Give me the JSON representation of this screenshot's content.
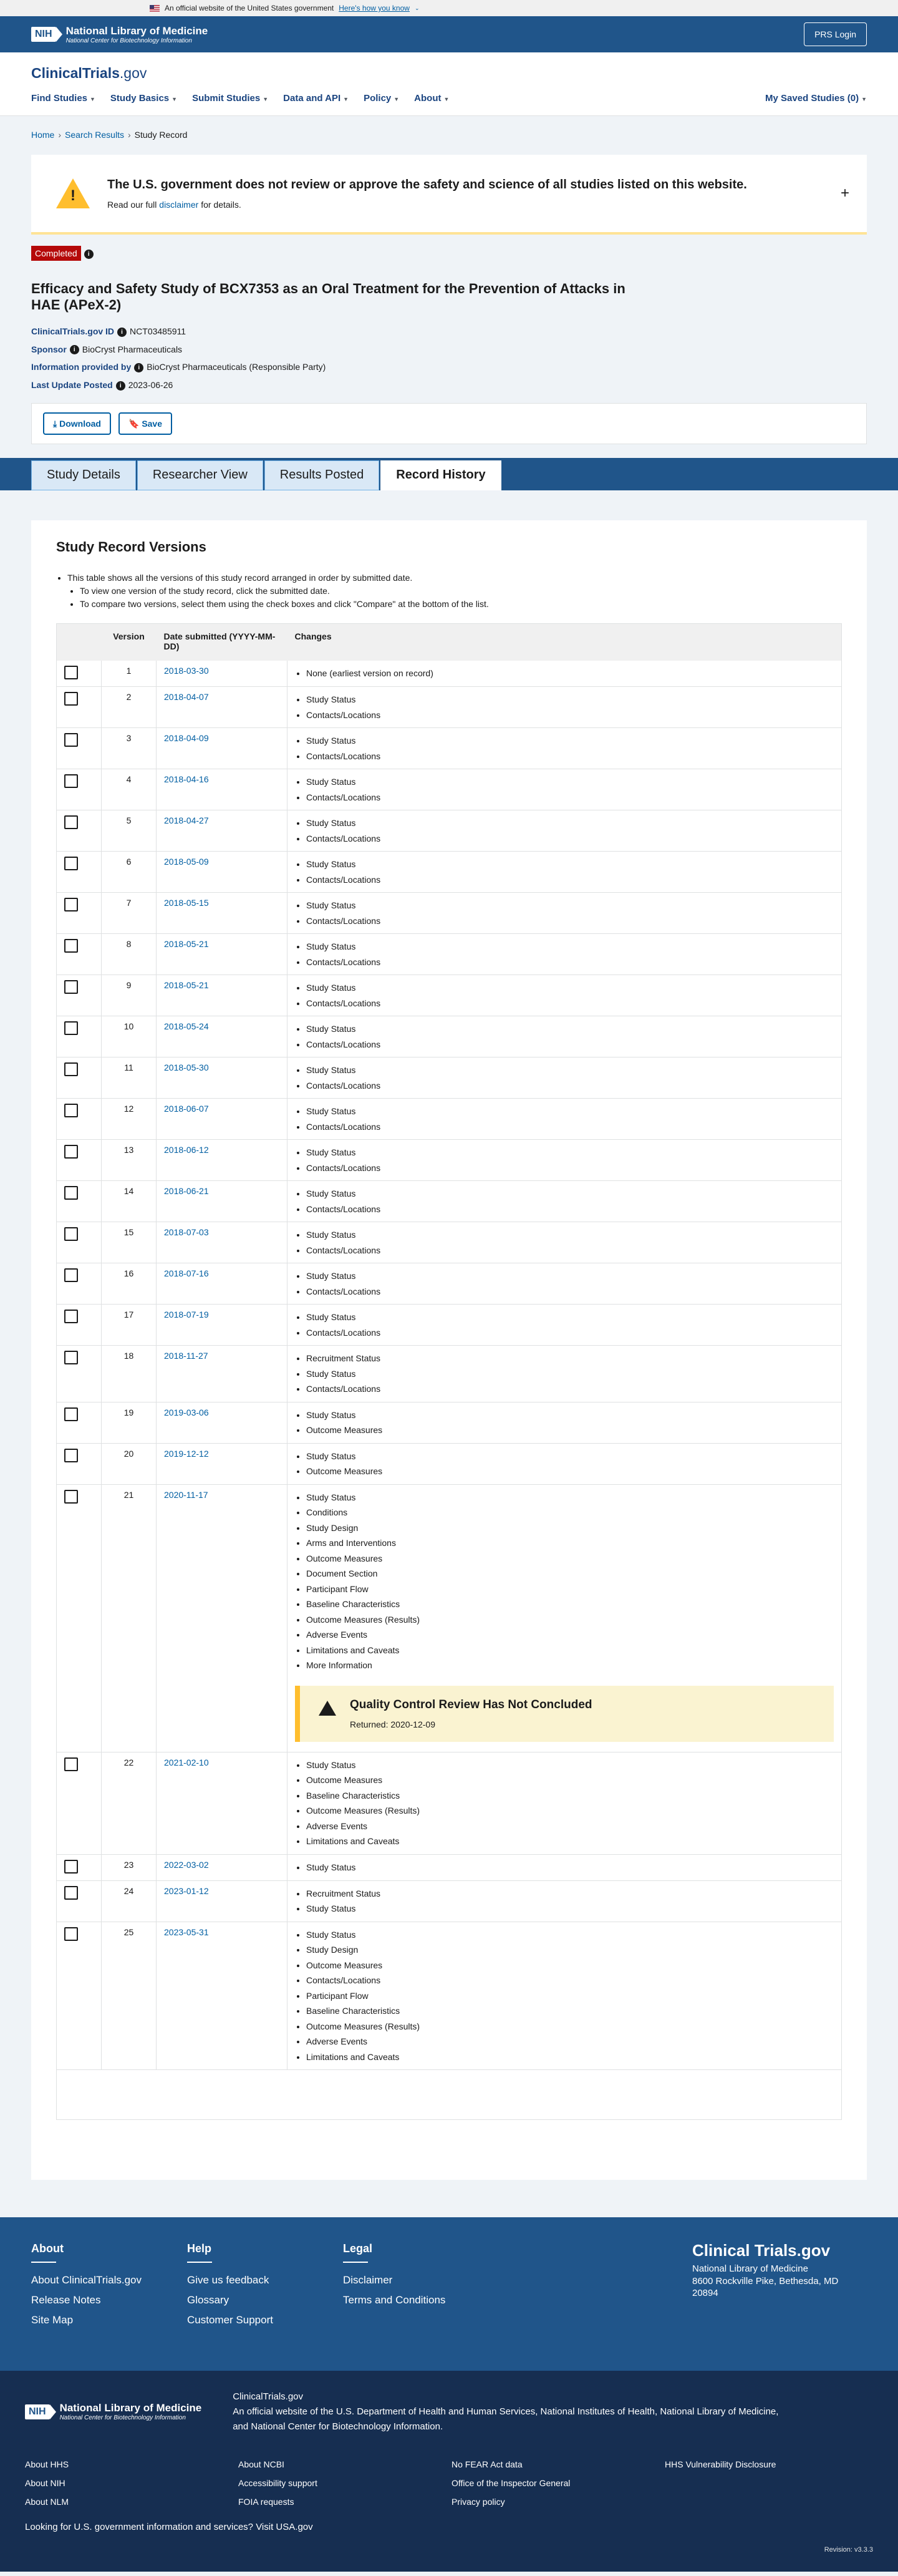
{
  "gov_banner": {
    "text": "An official website of the United States government",
    "link": "Here's how you know"
  },
  "nih": {
    "mark": "NIH",
    "title": "National Library of Medicine",
    "subtitle": "National Center for Biotechnology Information",
    "prs_login": "PRS Login"
  },
  "site": {
    "logo_main": "ClinicalTrials",
    "logo_gov": ".gov"
  },
  "nav": {
    "items": [
      "Find Studies",
      "Study Basics",
      "Submit Studies",
      "Data and API",
      "Policy",
      "About"
    ],
    "saved": "My Saved Studies (0)"
  },
  "breadcrumb": {
    "home": "Home",
    "search": "Search Results",
    "current": "Study Record"
  },
  "disclaimer": {
    "title": "The U.S. government does not review or approve the safety and science of all studies listed on this website.",
    "text_before": "Read our full",
    "link": "disclaimer",
    "text_after": "for details."
  },
  "study": {
    "status": "Completed",
    "title": "Efficacy and Safety Study of BCX7353 as an Oral Treatment for the Prevention of Attacks in HAE (APeX-2)",
    "id_label": "ClinicalTrials.gov ID",
    "id": "NCT03485911",
    "sponsor_label": "Sponsor",
    "sponsor": "BioCryst Pharmaceuticals",
    "provided_label": "Information provided by",
    "provided": "BioCryst Pharmaceuticals (Responsible Party)",
    "updated_label": "Last Update Posted",
    "updated": "2023-06-26"
  },
  "actions": {
    "download": "Download",
    "save": "Save"
  },
  "tabs": [
    "Study Details",
    "Researcher View",
    "Results Posted",
    "Record History"
  ],
  "versions": {
    "heading": "Study Record Versions",
    "intro": "This table shows all the versions of this study record arranged in order by submitted date.",
    "intro_sub1": "To view one version of the study record, click the submitted date.",
    "intro_sub2": "To compare two versions, select them using the check boxes and click \"Compare\" at the bottom of the list.",
    "col_version": "Version",
    "col_date": "Date submitted (YYYY-MM-DD)",
    "col_changes": "Changes",
    "rows": [
      {
        "v": "1",
        "d": "2018-03-30",
        "c": [
          "None (earliest version on record)"
        ]
      },
      {
        "v": "2",
        "d": "2018-04-07",
        "c": [
          "Study Status",
          "Contacts/Locations"
        ]
      },
      {
        "v": "3",
        "d": "2018-04-09",
        "c": [
          "Study Status",
          "Contacts/Locations"
        ]
      },
      {
        "v": "4",
        "d": "2018-04-16",
        "c": [
          "Study Status",
          "Contacts/Locations"
        ]
      },
      {
        "v": "5",
        "d": "2018-04-27",
        "c": [
          "Study Status",
          "Contacts/Locations"
        ]
      },
      {
        "v": "6",
        "d": "2018-05-09",
        "c": [
          "Study Status",
          "Contacts/Locations"
        ]
      },
      {
        "v": "7",
        "d": "2018-05-15",
        "c": [
          "Study Status",
          "Contacts/Locations"
        ]
      },
      {
        "v": "8",
        "d": "2018-05-21",
        "c": [
          "Study Status",
          "Contacts/Locations"
        ]
      },
      {
        "v": "9",
        "d": "2018-05-21",
        "c": [
          "Study Status",
          "Contacts/Locations"
        ]
      },
      {
        "v": "10",
        "d": "2018-05-24",
        "c": [
          "Study Status",
          "Contacts/Locations"
        ]
      },
      {
        "v": "11",
        "d": "2018-05-30",
        "c": [
          "Study Status",
          "Contacts/Locations"
        ]
      },
      {
        "v": "12",
        "d": "2018-06-07",
        "c": [
          "Study Status",
          "Contacts/Locations"
        ]
      },
      {
        "v": "13",
        "d": "2018-06-12",
        "c": [
          "Study Status",
          "Contacts/Locations"
        ]
      },
      {
        "v": "14",
        "d": "2018-06-21",
        "c": [
          "Study Status",
          "Contacts/Locations"
        ]
      },
      {
        "v": "15",
        "d": "2018-07-03",
        "c": [
          "Study Status",
          "Contacts/Locations"
        ]
      },
      {
        "v": "16",
        "d": "2018-07-16",
        "c": [
          "Study Status",
          "Contacts/Locations"
        ]
      },
      {
        "v": "17",
        "d": "2018-07-19",
        "c": [
          "Study Status",
          "Contacts/Locations"
        ]
      },
      {
        "v": "18",
        "d": "2018-11-27",
        "c": [
          "Recruitment Status",
          "Study Status",
          "Contacts/Locations"
        ]
      },
      {
        "v": "19",
        "d": "2019-03-06",
        "c": [
          "Study Status",
          "Outcome Measures"
        ]
      },
      {
        "v": "20",
        "d": "2019-12-12",
        "c": [
          "Study Status",
          "Outcome Measures"
        ]
      },
      {
        "v": "21",
        "d": "2020-11-17",
        "c": [
          "Study Status",
          "Conditions",
          "Study Design",
          "Arms and Interventions",
          "Outcome Measures",
          "Document Section",
          "Participant Flow",
          "Baseline Characteristics",
          "Outcome Measures (Results)",
          "Adverse Events",
          "Limitations and Caveats",
          "More Information"
        ],
        "qc": {
          "title": "Quality Control Review Has Not Concluded",
          "returned": "Returned: 2020-12-09"
        }
      },
      {
        "v": "22",
        "d": "2021-02-10",
        "c": [
          "Study Status",
          "Outcome Measures",
          "Baseline Characteristics",
          "Outcome Measures (Results)",
          "Adverse Events",
          "Limitations and Caveats"
        ]
      },
      {
        "v": "23",
        "d": "2022-03-02",
        "c": [
          "Study Status"
        ]
      },
      {
        "v": "24",
        "d": "2023-01-12",
        "c": [
          "Recruitment Status",
          "Study Status"
        ]
      },
      {
        "v": "25",
        "d": "2023-05-31",
        "c": [
          "Study Status",
          "Study Design",
          "Outcome Measures",
          "Contacts/Locations",
          "Participant Flow",
          "Baseline Characteristics",
          "Outcome Measures (Results)",
          "Adverse Events",
          "Limitations and Caveats"
        ]
      }
    ]
  },
  "footer": {
    "cols": [
      {
        "title": "About",
        "links": [
          "About ClinicalTrials.gov",
          "Release Notes",
          "Site Map"
        ]
      },
      {
        "title": "Help",
        "links": [
          "Give us feedback",
          "Glossary",
          "Customer Support"
        ]
      },
      {
        "title": "Legal",
        "links": [
          "Disclaimer",
          "Terms and Conditions"
        ]
      }
    ],
    "brand": "Clinical Trials.gov",
    "address1": "National Library of Medicine",
    "address2": "8600 Rockville Pike, Bethesda, MD 20894"
  },
  "nlm_footer": {
    "site": "ClinicalTrials.gov",
    "desc_pre": "An official website of the",
    "dept": "U.S. Department of Health and Human Services",
    "nih": "National Institutes of Health",
    "nlm": "National Library of Medicine",
    "ncbi": "National Center for Biotechnology Information",
    "links": [
      "About HHS",
      "About NCBI",
      "No FEAR Act data",
      "HHS Vulnerability Disclosure",
      "About NIH",
      "Accessibility support",
      "Office of the Inspector General",
      "",
      "About NLM",
      "FOIA requests",
      "Privacy policy",
      ""
    ],
    "usa_text": "Looking for U.S. government information and services?",
    "usa_link": "Visit USA.gov",
    "revision": "Revision: v3.3.3"
  }
}
